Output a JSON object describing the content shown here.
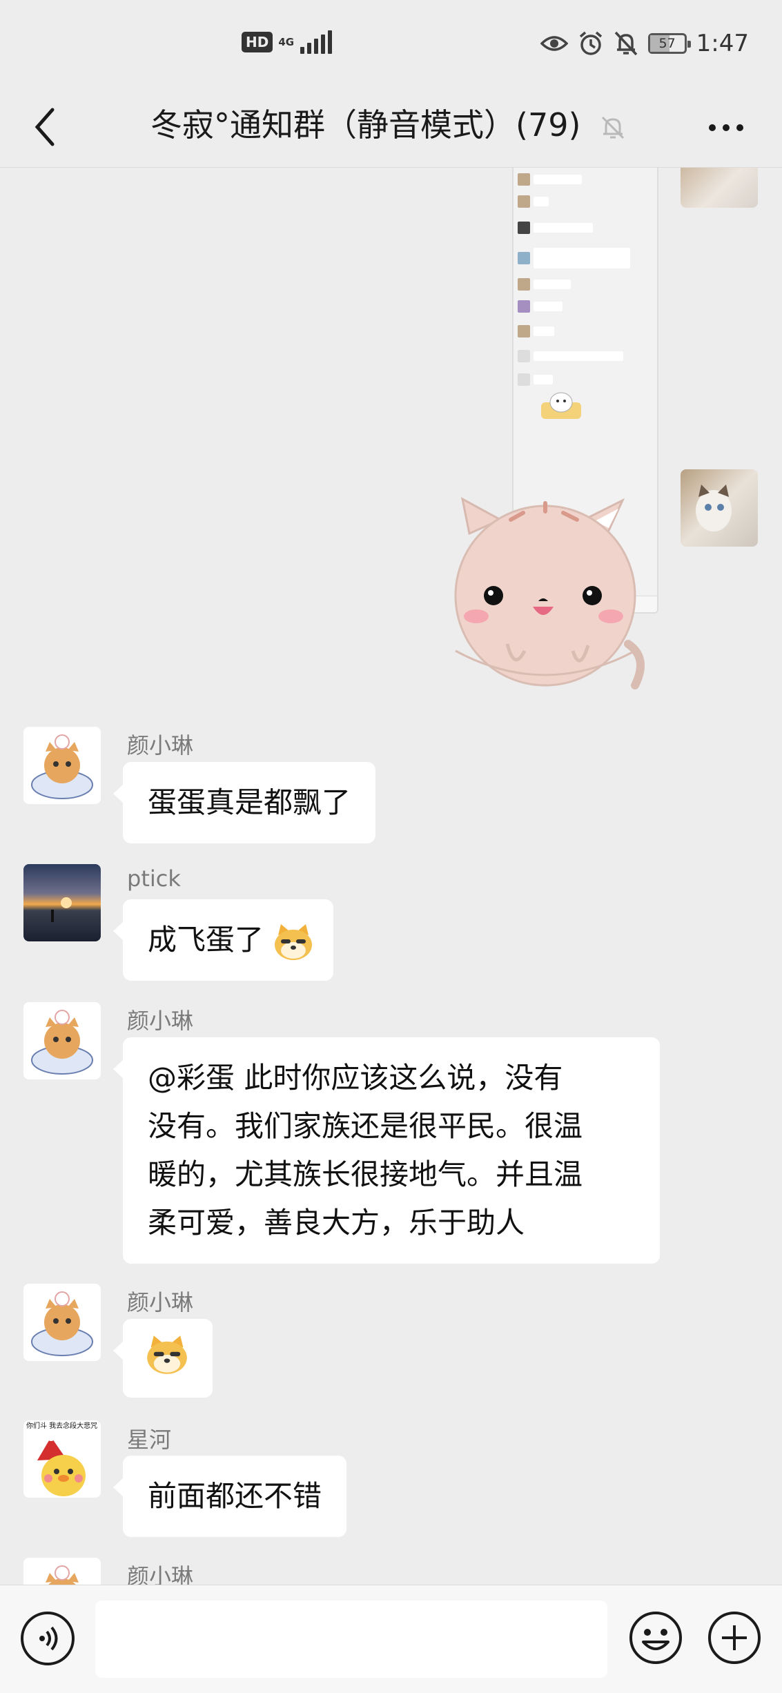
{
  "status_bar": {
    "hd_label": "HD",
    "network": "4G",
    "battery": "57",
    "time": "1:47",
    "icons": [
      "eye-icon",
      "alarm-icon",
      "bell-off-icon"
    ]
  },
  "header": {
    "title": "冬寂°通知群（静音模式）(79)",
    "back_icon": "chevron-left-icon",
    "mute_icon": "bell-muted-icon",
    "more_icon": "more-dots-icon"
  },
  "messages": [
    {
      "sender": "颜小琳",
      "text": "蛋蛋真是都飘了"
    },
    {
      "sender": "ptick",
      "text": "成飞蛋了"
    },
    {
      "sender": "颜小琳",
      "lines": [
        "@彩蛋  此时你应该这么说，没有",
        "没有。我们家族还是很平民。很温",
        "暖的，尤其族长很接地气。并且温",
        "柔可爱，善良大方，乐于助人"
      ]
    },
    {
      "sender": "颜小琳",
      "text": ""
    },
    {
      "sender": "星河",
      "text": "前面都还不错",
      "avatar_caption": "你们斗 我去念段大悲咒"
    },
    {
      "sender": "颜小琳",
      "text": ""
    }
  ],
  "input_bar": {
    "voice_icon": "voice-icon",
    "emoji_icon": "smile-icon",
    "plus_icon": "plus-circle-icon"
  },
  "colors": {
    "background": "#ededed",
    "bubble": "#ffffff",
    "name_text": "#7a7a7a",
    "input_bar": "#f7f7f7"
  }
}
